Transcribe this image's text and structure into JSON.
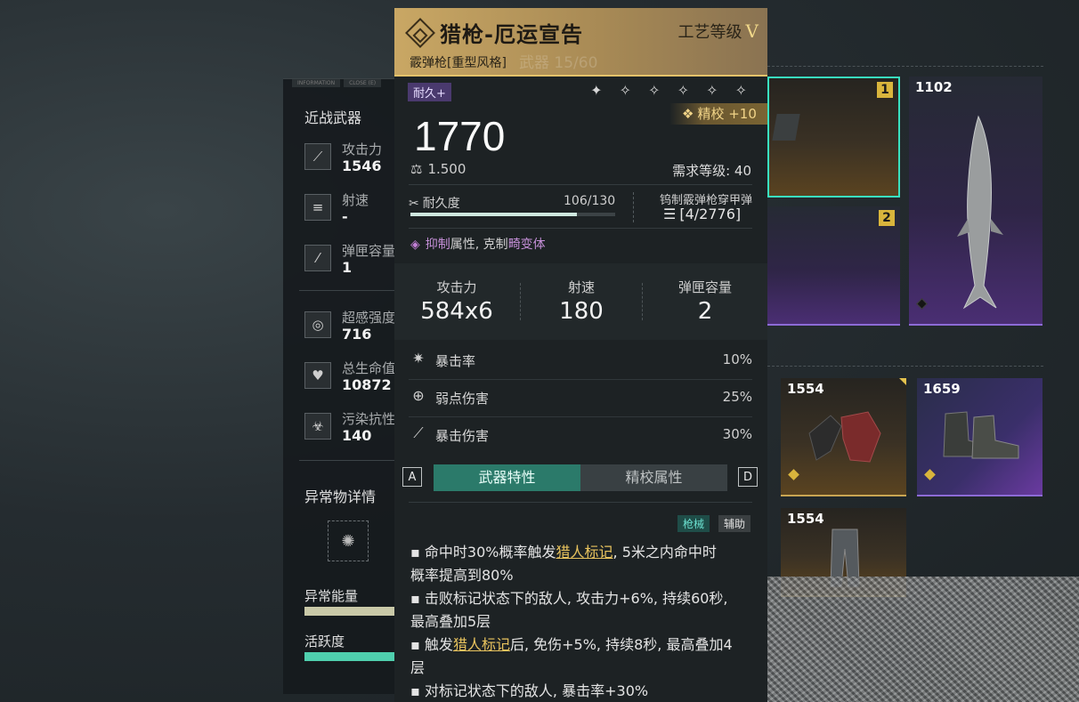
{
  "stats_panel": {
    "tabs": [
      "INFORMATION",
      "CLOSE (E)"
    ],
    "section_title": "近战武器",
    "weapon_stats": [
      {
        "label": "攻击力",
        "value": "1546",
        "icon": "claw-icon"
      },
      {
        "label": "射速",
        "value": "-",
        "icon": "speed-arrows-icon"
      },
      {
        "label": "弹匣容量",
        "value": "1",
        "icon": "bullet-icon"
      }
    ],
    "body_stats": [
      {
        "label": "超感强度",
        "value": "716",
        "icon": "swirl-icon"
      },
      {
        "label": "总生命值",
        "value": "10872",
        "icon": "heart-icon"
      },
      {
        "label": "污染抗性",
        "value": "140",
        "icon": "biohazard-icon"
      }
    ],
    "anomaly_title": "异常物详情",
    "energy_label": "异常能量",
    "energy_level": 0.95,
    "activity_label": "活跃度",
    "activity_level": 0.95
  },
  "detail": {
    "title": "猎枪-厄运宣告",
    "craft_label": "工艺等级",
    "craft_level": "V",
    "subtitle": "霰弹枪[重型风格]",
    "subtitle_faint": "武器 15/60",
    "tag": "耐久+",
    "stars": "✦ ✧ ✧ ✧ ✧ ✧",
    "refine": "精校 +10",
    "power": "1770",
    "weight": "1.500",
    "requirement": "需求等级: 40",
    "durability_label": "耐久度",
    "durability_value": "106/130",
    "durability_fraction": 0.815,
    "ammo_name": "钨制霰弹枪穿甲弹",
    "ammo_count": "[4/2776]",
    "trait_a": "抑制",
    "trait_b": "属性, 克制",
    "trait_c": "畸变体",
    "big_stats": [
      {
        "label": "攻击力",
        "value": "584x6"
      },
      {
        "label": "射速",
        "value": "180"
      },
      {
        "label": "弹匣容量",
        "value": "2"
      }
    ],
    "crit_stats": [
      {
        "label": "暴击率",
        "value": "10%"
      },
      {
        "label": "弱点伤害",
        "value": "25%"
      },
      {
        "label": "暴击伤害",
        "value": "30%"
      }
    ],
    "key_left": "A",
    "key_right": "D",
    "tab_active": "武器特性",
    "tab_inactive": "精校属性",
    "chip_gun": "枪械",
    "chip_aux": "辅助",
    "desc": {
      "l1a": "▪ 命中时30%概率触发",
      "l1b": "猎人标记",
      "l1c": ", 5米之内命中时",
      "l2": "概率提高到80%",
      "l3": "▪ 击败标记状态下的敌人, 攻击力+6%, 持续60秒,",
      "l4": "最高叠加5层",
      "l5a": "▪ 触发",
      "l5b": "猎人标记",
      "l5c": "后, 免伤+5%, 持续8秒, 最高叠加4",
      "l6": "层",
      "l7": "▪ 对标记状态下的敌人, 暴击率+30%"
    }
  },
  "inventory": {
    "cards": [
      {
        "num": "",
        "slot": "1"
      },
      {
        "num": "1102",
        "slot": ""
      },
      {
        "num": "",
        "slot": "2"
      },
      {
        "num": "1554",
        "slot": ""
      },
      {
        "num": "1659",
        "slot": ""
      },
      {
        "num": "1554",
        "slot": ""
      }
    ]
  }
}
